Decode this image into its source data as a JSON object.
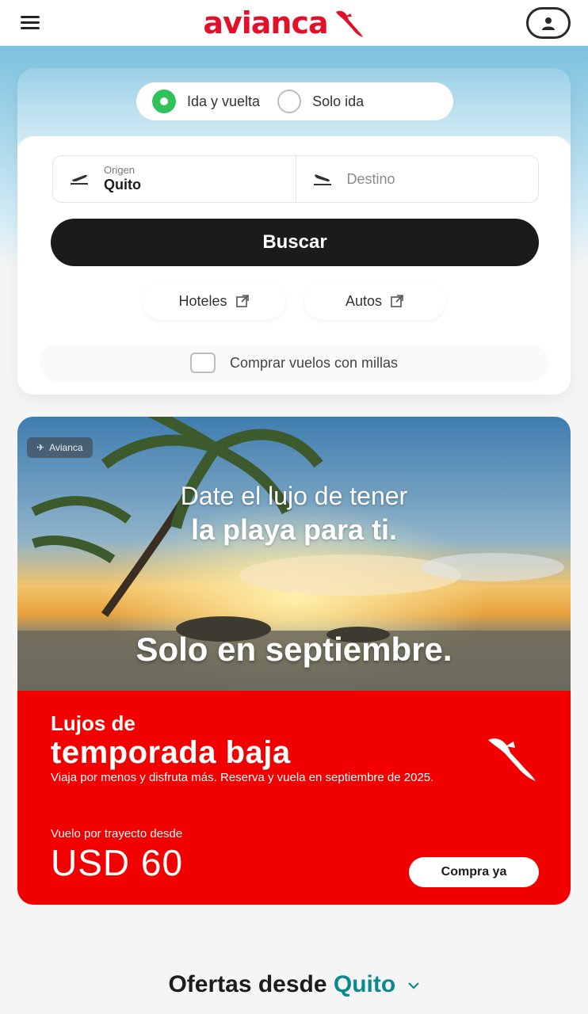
{
  "header": {
    "brand": "avianca"
  },
  "trip_type": {
    "options": [
      "Ida y vuelta",
      "Solo ida"
    ],
    "selected": "Ida y vuelta"
  },
  "search": {
    "origin_label": "Origen",
    "origin_value": "Quito",
    "destination_placeholder": "Destino",
    "button_label": "Buscar"
  },
  "links": {
    "hoteles": "Hoteles",
    "autos": "Autos"
  },
  "miles": {
    "label": "Comprar vuelos con millas"
  },
  "promo": {
    "badge": "Avianca",
    "head1": "Date el lujo de tener",
    "head2": "la playa para ti.",
    "head3": "Solo en septiembre.",
    "kicker": "Lujos de",
    "title": "temporada baja",
    "description": "Viaja por menos y disfruta más. Reserva y vuela en septiembre de 2025.",
    "from_label": "Vuelo por trayecto desde",
    "price": "USD 60",
    "cta": "Compra ya"
  },
  "offers": {
    "title_prefix": "Ofertas desde",
    "city": "Quito"
  },
  "colors": {
    "brand_red": "#e3102a",
    "promo_red": "#f20000",
    "accent_green": "#2fc25b",
    "button_dark": "#1b1b1b",
    "link_teal": "#0a8a8f"
  }
}
